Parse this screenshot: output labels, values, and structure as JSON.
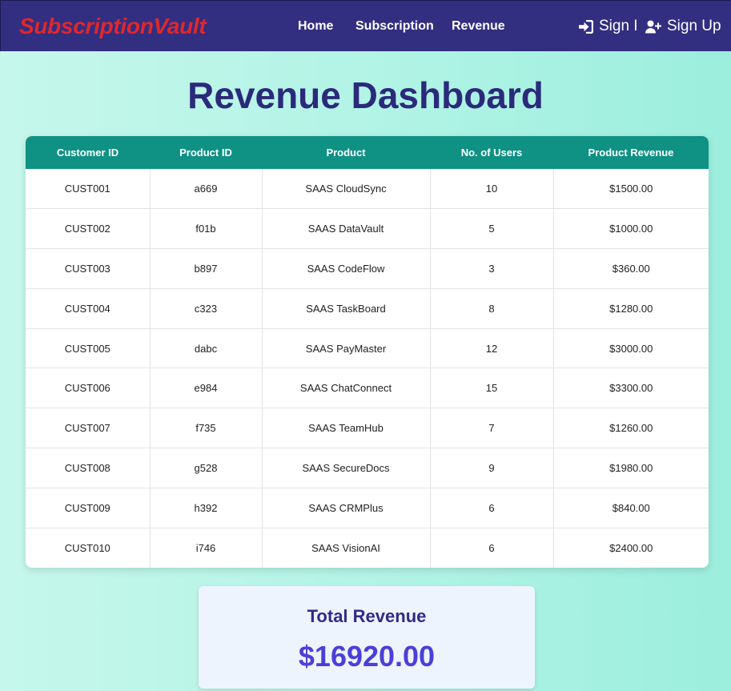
{
  "nav": {
    "brand": "SubscriptionVault",
    "links": [
      "Home",
      "Subscription",
      "Revenue"
    ],
    "sign_in": "Sign I",
    "sign_up": "Sign Up"
  },
  "page": {
    "title": "Revenue Dashboard"
  },
  "table": {
    "headers": [
      "Customer ID",
      "Product ID",
      "Product",
      "No. of Users",
      "Product Revenue"
    ],
    "rows": [
      [
        "CUST001",
        "a669",
        "SAAS CloudSync",
        "10",
        "$1500.00"
      ],
      [
        "CUST002",
        "f01b",
        "SAAS DataVault",
        "5",
        "$1000.00"
      ],
      [
        "CUST003",
        "b897",
        "SAAS CodeFlow",
        "3",
        "$360.00"
      ],
      [
        "CUST004",
        "c323",
        "SAAS TaskBoard",
        "8",
        "$1280.00"
      ],
      [
        "CUST005",
        "dabc",
        "SAAS PayMaster",
        "12",
        "$3000.00"
      ],
      [
        "CUST006",
        "e984",
        "SAAS ChatConnect",
        "15",
        "$3300.00"
      ],
      [
        "CUST007",
        "f735",
        "SAAS TeamHub",
        "7",
        "$1260.00"
      ],
      [
        "CUST008",
        "g528",
        "SAAS SecureDocs",
        "9",
        "$1980.00"
      ],
      [
        "CUST009",
        "h392",
        "SAAS CRMPlus",
        "6",
        "$840.00"
      ],
      [
        "CUST010",
        "i746",
        "SAAS VisionAI",
        "6",
        "$2400.00"
      ]
    ]
  },
  "summary": {
    "label": "Total Revenue",
    "value": "$16920.00"
  },
  "icons": {
    "sign_in": "sign-in-icon",
    "sign_up": "user-plus-icon"
  },
  "colors": {
    "navbar": "#322e80",
    "brand": "#e0272b",
    "table_header": "#0f9184",
    "title": "#2b2a7a",
    "total_value": "#4b3fd9"
  }
}
